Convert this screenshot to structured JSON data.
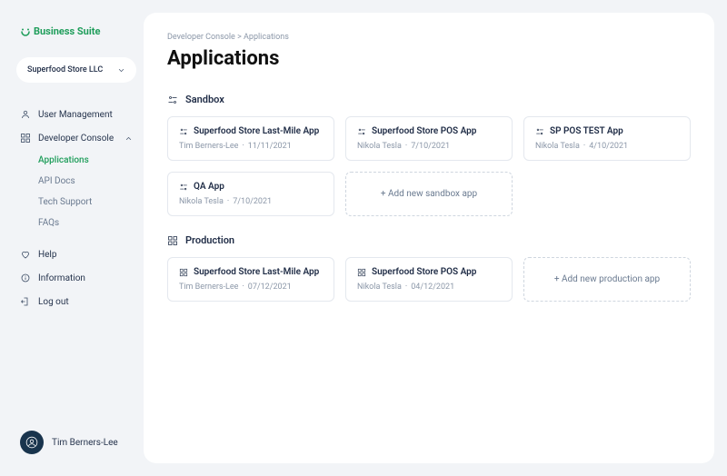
{
  "brand": {
    "name": "Business Suite"
  },
  "store_selector": {
    "label": "Superfood Store LLC"
  },
  "nav": {
    "items": [
      {
        "label": "User Management"
      },
      {
        "label": "Developer Console",
        "expanded": true,
        "children": [
          {
            "label": "Applications",
            "active": true
          },
          {
            "label": "API Docs"
          },
          {
            "label": "Tech Support"
          },
          {
            "label": "FAQs"
          }
        ]
      },
      {
        "label": "Help"
      },
      {
        "label": "Information"
      },
      {
        "label": "Log out"
      }
    ]
  },
  "user": {
    "name": "Tim Berners-Lee"
  },
  "breadcrumb": {
    "a": "Developer Console",
    "b": "Applications",
    "sep": ">"
  },
  "page": {
    "title": "Applications"
  },
  "sections": {
    "sandbox": {
      "title": "Sandbox",
      "add_label": "+ Add new sandbox app",
      "apps": [
        {
          "name": "Superfood Store Last-Mile App",
          "author": "Tim Berners-Lee",
          "date": "11/11/2021"
        },
        {
          "name": "Superfood Store POS App",
          "author": "Nikola Tesla",
          "date": "7/10/2021"
        },
        {
          "name": "SP POS TEST App",
          "author": "Nikola Tesla",
          "date": "4/10/2021"
        },
        {
          "name": "QA App",
          "author": "Nikola Tesla",
          "date": "7/10/2021"
        }
      ]
    },
    "production": {
      "title": "Production",
      "add_label": "+ Add new production app",
      "apps": [
        {
          "name": "Superfood Store Last-Mile App",
          "author": "Tim Berners-Lee",
          "date": "07/12/2021"
        },
        {
          "name": "Superfood Store POS App",
          "author": "Nikola Tesla",
          "date": "04/12/2021"
        }
      ]
    }
  }
}
